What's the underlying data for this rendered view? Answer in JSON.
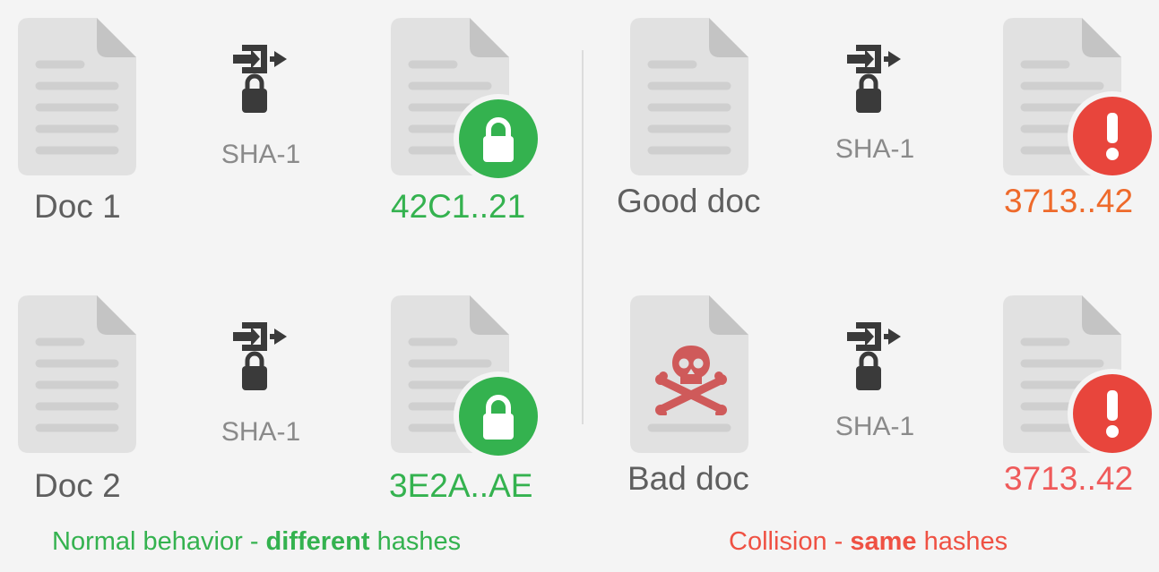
{
  "left": {
    "row1": {
      "doc_label": "Doc 1",
      "function_label": "SHA-1",
      "hash": "42C1..21"
    },
    "row2": {
      "doc_label": "Doc 2",
      "function_label": "SHA-1",
      "hash": "3E2A..AE"
    },
    "caption": {
      "pre": "Normal behavior - ",
      "bold": "different",
      "post": " hashes"
    }
  },
  "right": {
    "row1": {
      "doc_label": "Good doc",
      "function_label": "SHA-1",
      "hash": "3713..42"
    },
    "row2": {
      "doc_label": "Bad doc",
      "function_label": "SHA-1",
      "hash": "3713..42"
    },
    "caption": {
      "pre": "Collision - ",
      "bold": "same",
      "post": " hashes"
    }
  },
  "colors": {
    "green": "#34b24f",
    "red": "#ef5143",
    "document": "#e1e1e1",
    "icon": "#3a3a3a"
  },
  "icons": {
    "hash_function": "enter-arrow-lock-icon",
    "ok_badge": "lock-icon",
    "warn_badge": "exclamation-icon",
    "malicious": "skull-crossbones-icon"
  }
}
